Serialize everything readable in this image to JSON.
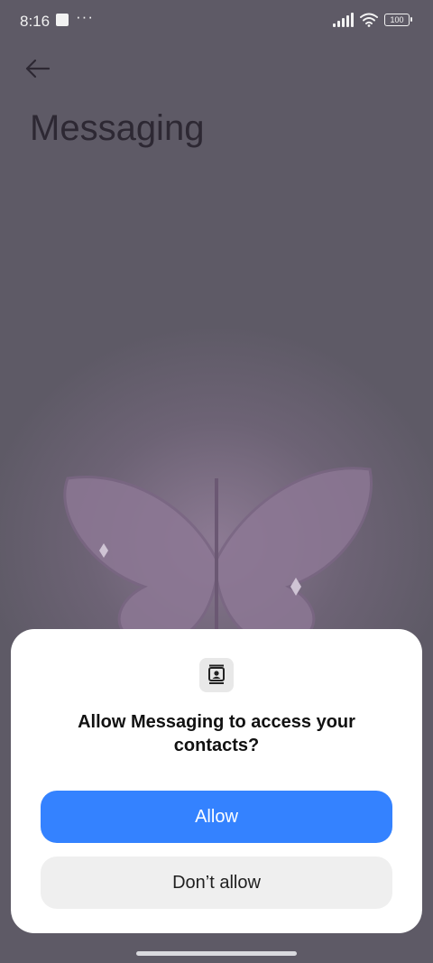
{
  "status_bar": {
    "time": "8:16",
    "dots": "···",
    "battery": "100"
  },
  "header": {
    "title": "Messaging"
  },
  "dialog": {
    "question": "Allow Messaging to access your contacts?",
    "allow_label": "Allow",
    "deny_label": "Don’t allow"
  },
  "colors": {
    "accent": "#3482ff",
    "dialog_bg": "#ffffff",
    "secondary_button": "#efefef"
  },
  "icons": {
    "back": "arrow-left-icon",
    "permission": "contacts-icon",
    "wifi": "wifi-icon",
    "signal": "signal-icon",
    "battery": "battery-icon"
  }
}
